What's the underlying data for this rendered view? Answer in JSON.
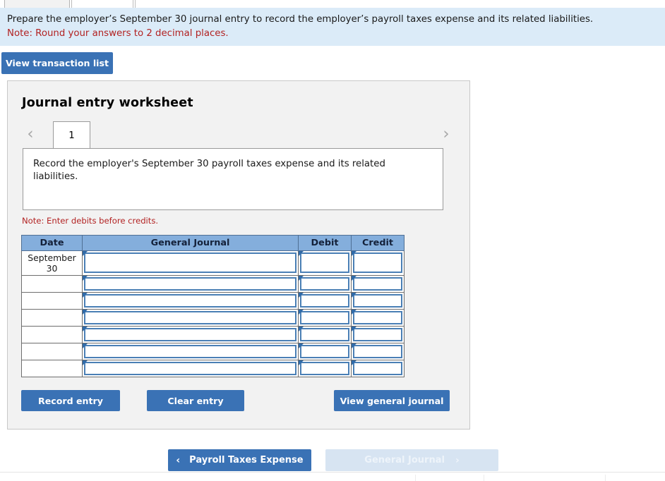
{
  "top_tabs": [
    {
      "name": "tab-left-partial",
      "state": "inactive",
      "label": ""
    },
    {
      "name": "tab-middle-partial",
      "state": "active",
      "label": ""
    },
    {
      "name": "tab-right-partial",
      "state": "active",
      "label": ""
    }
  ],
  "banner": {
    "instruction": "Prepare the employer’s September 30 journal entry to record the employer’s payroll taxes expense and its related liabilities.",
    "note": "Note: Round your answers to 2 decimal places.",
    "background_color": "#dbebf8",
    "note_color": "#b22222"
  },
  "toolbar": {
    "view_transaction_list_label": "View transaction list"
  },
  "worksheet": {
    "title": "Journal entry worksheet",
    "prev_icon": "chevron-left-icon",
    "next_icon": "chevron-right-icon",
    "prev_glyph": "‹",
    "next_glyph": "›",
    "pages": [
      {
        "label": "1",
        "selected": true
      }
    ],
    "instruction": "Record the employer's September 30 payroll taxes expense and its related liabilities.",
    "note_debits": "Note: Enter debits before credits.",
    "note_color": "#b22222",
    "panel_background": "#f2f2f2"
  },
  "journal_table": {
    "header_color": "#84aedc",
    "cell_border_color": "#4a7fb5",
    "columns": [
      {
        "key": "date",
        "label": "Date"
      },
      {
        "key": "general_journal",
        "label": "General Journal"
      },
      {
        "key": "debit",
        "label": "Debit"
      },
      {
        "key": "credit",
        "label": "Credit"
      }
    ],
    "rows": [
      {
        "date": "September 30",
        "general_journal": "",
        "debit": "",
        "credit": "",
        "tall": true
      },
      {
        "date": "",
        "general_journal": "",
        "debit": "",
        "credit": "",
        "tall": false
      },
      {
        "date": "",
        "general_journal": "",
        "debit": "",
        "credit": "",
        "tall": false
      },
      {
        "date": "",
        "general_journal": "",
        "debit": "",
        "credit": "",
        "tall": false
      },
      {
        "date": "",
        "general_journal": "",
        "debit": "",
        "credit": "",
        "tall": false
      },
      {
        "date": "",
        "general_journal": "",
        "debit": "",
        "credit": "",
        "tall": false
      },
      {
        "date": "",
        "general_journal": "",
        "debit": "",
        "credit": "",
        "tall": false
      }
    ]
  },
  "actions": {
    "record_entry_label": "Record entry",
    "clear_entry_label": "Clear entry",
    "view_general_journal_label": "View general journal",
    "button_color": "#3a72b5"
  },
  "bottom_nav": {
    "prev_label": "Payroll Taxes Expense",
    "prev_arrow": "‹",
    "prev_icon": "chevron-left-icon",
    "prev_enabled": true,
    "next_label": "General Journal",
    "next_arrow": "›",
    "next_icon": "chevron-right-icon",
    "next_enabled": false
  }
}
